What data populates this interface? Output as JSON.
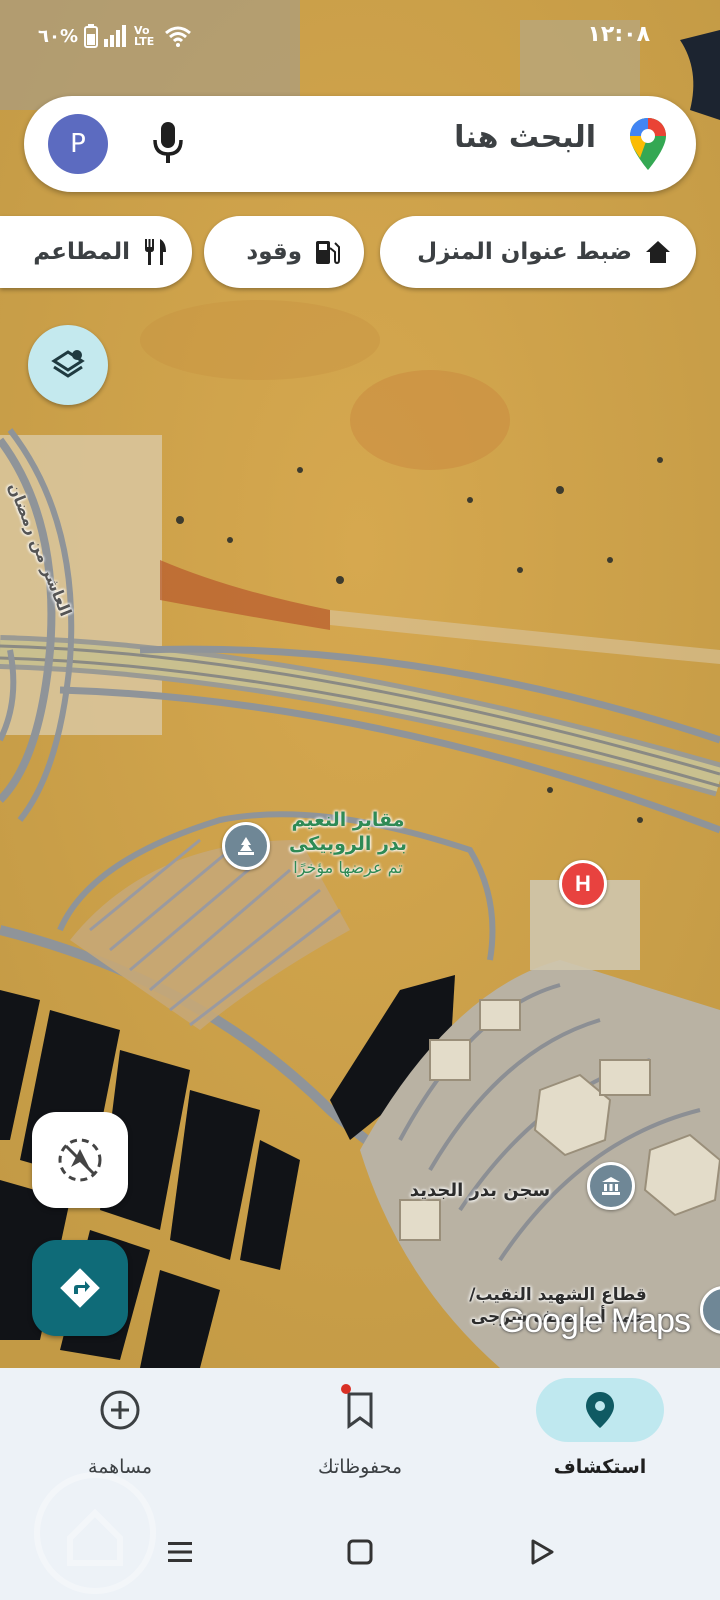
{
  "status_bar": {
    "time": "١٢:٠٨",
    "battery": "٦٠%",
    "network": "Vo LTE"
  },
  "search": {
    "placeholder": "البحث هنا",
    "avatar_letter": "P"
  },
  "chips": [
    {
      "label": "ضبط عنوان المنزل",
      "icon": "home-icon"
    },
    {
      "label": "وقود",
      "icon": "gas-station-icon"
    },
    {
      "label": "المطاعم",
      "icon": "restaurant-icon"
    }
  ],
  "map": {
    "poi_cemetery": {
      "line1": "مقابر النعيم",
      "line2": "بدر الروبيكى",
      "note": "تم عرضها مؤخرًا"
    },
    "poi_prison": {
      "label": "سجن بدر الجديد"
    },
    "poi_sector": {
      "line1": "قطاع الشهيد النقيب/",
      "line2": "حمد أبو ضيف سرجى"
    },
    "road_label": "العاشر من رمضان",
    "watermark": "Google Maps"
  },
  "bottom_nav": [
    {
      "label": "استكشاف",
      "icon": "explore-pin-icon",
      "active": true
    },
    {
      "label": "محفوظاتك",
      "icon": "bookmark-icon",
      "active": false
    },
    {
      "label": "مساهمة",
      "icon": "add-circle-icon",
      "active": false
    }
  ],
  "colors": {
    "accent": "#0f6b78",
    "active_nav_bg": "#bfe8ef",
    "avatar_bg": "#5c6bc0",
    "hospital_red": "#e8423f"
  }
}
